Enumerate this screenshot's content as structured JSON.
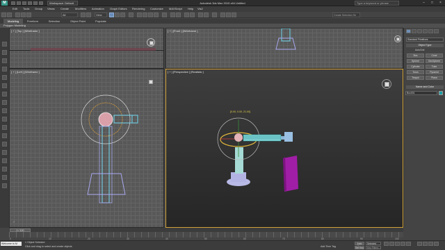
{
  "titlebar": {
    "workspace": "Workspace: Default",
    "title": "Autodesk 3ds Max 2015 x64    Untitled",
    "search_placeholder": "Type a keyword or phrase",
    "logo": "M"
  },
  "menu": [
    "Edit",
    "Tools",
    "Group",
    "Views",
    "Create",
    "Modifiers",
    "Animation",
    "Graph Editors",
    "Rendering",
    "Customize",
    "MAXScript",
    "Help",
    "Vis2"
  ],
  "toolbar": {
    "selection_filter": "All",
    "reference_coord": "View",
    "named_selection_placeholder": "Create Selection Se"
  },
  "ribbon": {
    "tabs": [
      "Modeling",
      "Freeform",
      "Selection",
      "Object Paint",
      "Populate"
    ],
    "active_tab": "Modeling",
    "subpanel": "Polygon Modeling"
  },
  "viewports": {
    "top": "[ + ] [Top ] [Wireframe ]",
    "front": "[ + ] [Front ] [Wireframe ]",
    "left": "[ + ] [Left ] [Wireframe ]",
    "perspective": "[ + ] [Perspective ] [Realistic ]",
    "gizmo_readout": "[0.00, 0.00, 21.00]"
  },
  "command_panel": {
    "category": "Standard Primitives",
    "object_type_header": "Object Type",
    "autogrid": "AutoGrid",
    "object_buttons": [
      "Box",
      "Cone",
      "Sphere",
      "GeoSphere",
      "Cylinder",
      "Tube",
      "Torus",
      "Pyramid",
      "Teapot",
      "Plane"
    ],
    "name_color_header": "Name and Color",
    "object_name": "Box001",
    "object_color": "#1aa0a6"
  },
  "timeline": {
    "frame_readout": "0 / 100",
    "ticks": [
      "0",
      "10",
      "20",
      "30",
      "40",
      "50",
      "60",
      "70",
      "80",
      "90",
      "100"
    ]
  },
  "status": {
    "maxscript": "Welcome to M",
    "selection": "1 Object Selected",
    "prompt": "Click and drag to select and create objects",
    "add_time_tag": "Add Time Tag",
    "autokey": "Auto Key",
    "selected": "Selected",
    "setkey": "Set Key",
    "key_filters": "Key Filters..."
  }
}
